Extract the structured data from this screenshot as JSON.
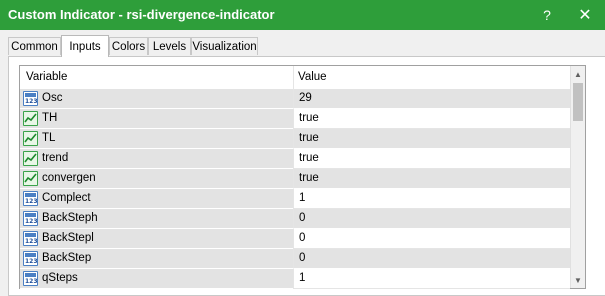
{
  "window": {
    "title": "Custom Indicator - rsi-divergence-indicator",
    "help_glyph": "?",
    "close_glyph": "✕"
  },
  "tabs": [
    {
      "label": "Common"
    },
    {
      "label": "Inputs",
      "active": true
    },
    {
      "label": "Colors"
    },
    {
      "label": "Levels"
    },
    {
      "label": "Visualization"
    }
  ],
  "grid": {
    "headers": {
      "variable": "Variable",
      "value": "Value"
    },
    "rows": [
      {
        "name": "Osc",
        "value": "29",
        "icon": "numeric-param-icon"
      },
      {
        "name": "TH",
        "value": "true",
        "icon": "boolean-param-icon"
      },
      {
        "name": "TL",
        "value": "true",
        "icon": "boolean-param-icon"
      },
      {
        "name": "trend",
        "value": "true",
        "icon": "boolean-param-icon"
      },
      {
        "name": "convergen",
        "value": "true",
        "icon": "boolean-param-icon"
      },
      {
        "name": "Complect",
        "value": "1",
        "icon": "numeric-param-icon"
      },
      {
        "name": "BackSteph",
        "value": "0",
        "icon": "numeric-param-icon"
      },
      {
        "name": "BackStepl",
        "value": "0",
        "icon": "numeric-param-icon"
      },
      {
        "name": "BackStep",
        "value": "0",
        "icon": "numeric-param-icon"
      },
      {
        "name": "qSteps",
        "value": "1",
        "icon": "numeric-param-icon"
      }
    ]
  },
  "colors": {
    "titlebar": "#2e9e3a",
    "row_shade": "#e3e3e3"
  }
}
